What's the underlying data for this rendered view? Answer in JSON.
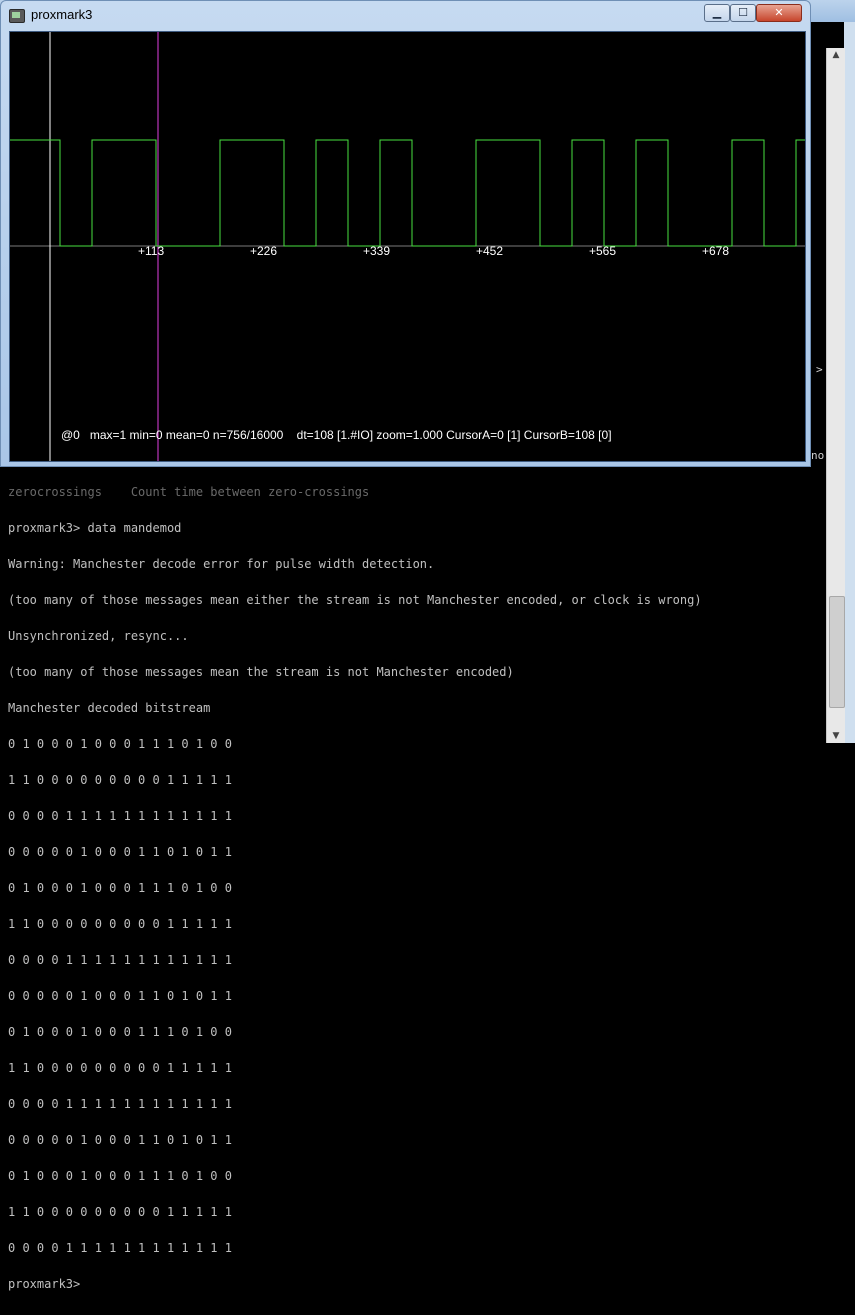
{
  "graph_window": {
    "title": "proxmark3",
    "buttons": {
      "minimize": "▁",
      "maximize": "☐",
      "close": "✕"
    },
    "tick_labels": [
      "+113",
      "+226",
      "+339",
      "+452",
      "+565",
      "+678"
    ],
    "status": "@0   max=1 min=0 mean=0 n=756/16000    dt=108 [1.#IO] zoom=1.000 CursorA=0 [1] CursorB=108 [0]",
    "colors": {
      "signal": "#48e040",
      "cursor_a": "#ffffff",
      "cursor_b": "#e040e0",
      "axis": "#7a7a7a"
    }
  },
  "console": {
    "side_glyphs": [
      ">",
      "no"
    ],
    "lines": [
      "zerocrossings    Count time between zero-crossings",
      "Warning: Manchester decode error for pulse width detection.",
      "(too many of those messages mean either the stream is not Manchester encoded, or clock is wrong)",
      "Unsynchronized, resync...",
      "(too many of those messages mean the stream is not Manchester encoded)",
      "Manchester decoded bitstream",
      "0 1 0 0 0 1 0 0 0 1 1 1 0 1 0 0",
      "1 1 0 0 0 0 0 0 0 0 0 1 1 1 1 1",
      "0 0 0 0 1 1 1 1 1 1 1 1 1 1 1 1",
      "0 0 0 0 0 1 0 0 0 1 1 0 1 0 1 1",
      "0 1 0 0 0 1 0 0 0 1 1 1 0 1 0 0",
      "1 1 0 0 0 0 0 0 0 0 0 1 1 1 1 1",
      "0 0 0 0 1 1 1 1 1 1 1 1 1 1 1 1",
      "0 0 0 0 0 1 0 0 0 1 1 0 1 0 1 1",
      "0 1 0 0 0 1 0 0 0 1 1 1 0 1 0 0",
      "1 1 0 0 0 0 0 0 0 0 0 1 1 1 1 1",
      "0 0 0 0 1 1 1 1 1 1 1 1 1 1 1 1",
      "0 0 0 0 0 1 0 0 0 1 1 0 1 0 1 1",
      "0 1 0 0 0 1 0 0 0 1 1 1 0 1 0 0",
      "1 1 0 0 0 0 0 0 0 0 0 1 1 1 1 1",
      "0 0 0 0 1 1 1 1 1 1 1 1 1 1 1 1",
      "proxmark3>"
    ],
    "command_line": "proxmark3> data mandemod"
  }
}
